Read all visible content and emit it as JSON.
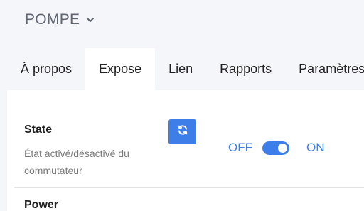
{
  "header": {
    "title": "POMPE",
    "dropdown_icon": "chevron-down-icon"
  },
  "tabs": [
    {
      "label": "À propos",
      "active": false
    },
    {
      "label": "Expose",
      "active": true
    },
    {
      "label": "Lien",
      "active": false
    },
    {
      "label": "Rapports",
      "active": false
    },
    {
      "label": "Paramètres",
      "active": false
    }
  ],
  "exposes": {
    "state": {
      "name": "State",
      "description": "État activé/désactivé du commutateur",
      "refresh_icon": "refresh-icon",
      "off_label": "OFF",
      "on_label": "ON",
      "value": "ON"
    },
    "power": {
      "name": "Power"
    }
  },
  "colors": {
    "accent": "#3e7ee8",
    "background": "#f5f6fa",
    "panel": "#ffffff"
  }
}
